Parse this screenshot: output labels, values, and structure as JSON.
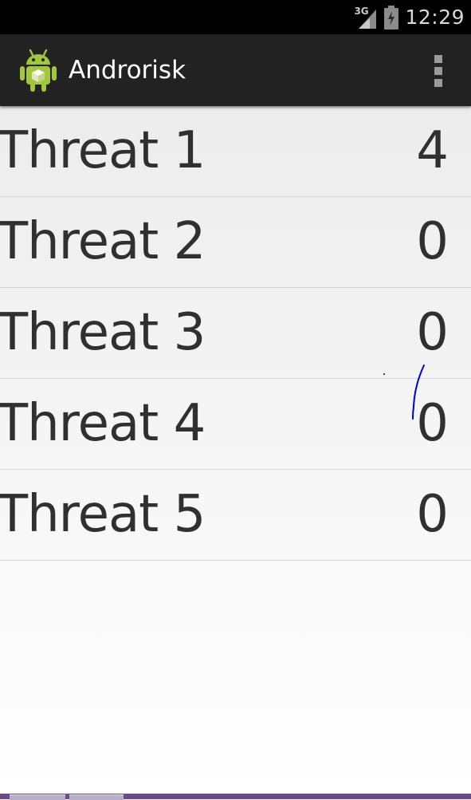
{
  "status_bar": {
    "network_label": "3G",
    "time": "12:29"
  },
  "action_bar": {
    "app_name": "Androrisk",
    "app_icon": "android-robot-icon",
    "menu_icon": "overflow-menu-icon"
  },
  "threats": [
    {
      "name": "Threat 1",
      "count": "4"
    },
    {
      "name": "Threat 2",
      "count": "0"
    },
    {
      "name": "Threat 3",
      "count": "0"
    },
    {
      "name": "Threat 4",
      "count": "0"
    },
    {
      "name": "Threat 5",
      "count": "0"
    }
  ],
  "colors": {
    "status_bar_bg": "#000000",
    "action_bar_bg": "#222222",
    "list_text": "#303030",
    "divider": "#d4d4d4",
    "android_green": "#a4c639",
    "annotation_stroke": "#0000cc",
    "taskbar": "#6b4a8e"
  }
}
